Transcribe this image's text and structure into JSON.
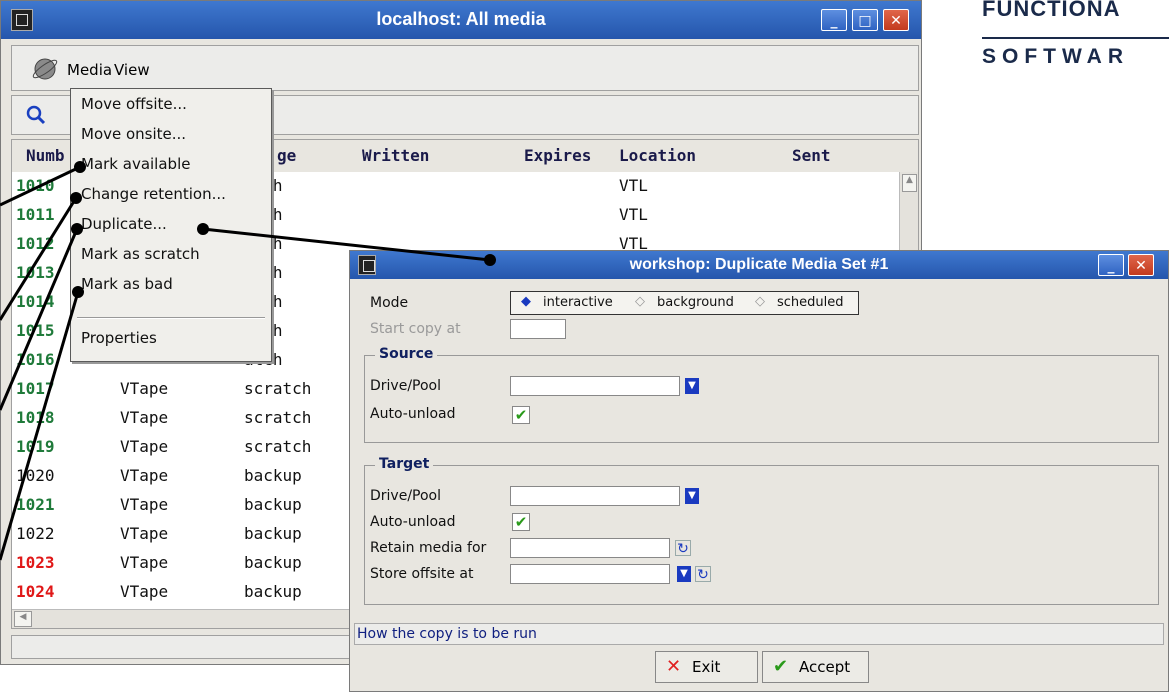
{
  "logo": {
    "line1": "FUNCTIONA",
    "line2": "SOFTWAR"
  },
  "main_window": {
    "title": "localhost: All media",
    "menus": [
      "Media",
      "View"
    ],
    "columns": [
      "Numb",
      "ge",
      "Written",
      "Expires",
      "Location",
      "Sent"
    ],
    "rows": [
      {
        "number": "1010",
        "type": "",
        "stage": "atch",
        "location": "VTL",
        "color": "#1f7a3a"
      },
      {
        "number": "1011",
        "type": "",
        "stage": "atch",
        "location": "VTL",
        "color": "#1f7a3a"
      },
      {
        "number": "1012",
        "type": "",
        "stage": "atch",
        "location": "VTL",
        "color": "#1f7a3a"
      },
      {
        "number": "1013",
        "type": "",
        "stage": "atch",
        "location": "",
        "color": "#1f7a3a"
      },
      {
        "number": "1014",
        "type": "",
        "stage": "atch",
        "location": "",
        "color": "#1f7a3a"
      },
      {
        "number": "1015",
        "type": "",
        "stage": "atch",
        "location": "",
        "color": "#1f7a3a"
      },
      {
        "number": "1016",
        "type": "",
        "stage": "atch",
        "location": "",
        "color": "#1f7a3a"
      },
      {
        "number": "1017",
        "type": "VTape",
        "stage": "scratch",
        "location": "",
        "color": "#1f7a3a"
      },
      {
        "number": "1018",
        "type": "VTape",
        "stage": "scratch",
        "location": "",
        "color": "#1f7a3a"
      },
      {
        "number": "1019",
        "type": "VTape",
        "stage": "scratch",
        "location": "",
        "color": "#1f7a3a"
      },
      {
        "number": "1020",
        "type": "VTape",
        "stage": "backup",
        "location": "",
        "color": "#111111"
      },
      {
        "number": "1021",
        "type": "VTape",
        "stage": "backup",
        "location": "",
        "color": "#1f7a3a"
      },
      {
        "number": "1022",
        "type": "VTape",
        "stage": "backup",
        "location": "",
        "color": "#111111"
      },
      {
        "number": "1023",
        "type": "VTape",
        "stage": "backup",
        "location": "",
        "color": "#e01818"
      },
      {
        "number": "1024",
        "type": "VTape",
        "stage": "backup",
        "location": "",
        "color": "#e01818"
      }
    ]
  },
  "dropdown": {
    "items": [
      "Move offsite...",
      "Move onsite...",
      "Mark available",
      "Change retention...",
      "Duplicate...",
      "Mark as scratch",
      "Mark as bad"
    ],
    "properties": "Properties"
  },
  "dialog": {
    "title": "workshop: Duplicate Media Set #1",
    "mode_label": "Mode",
    "mode_options": [
      "interactive",
      "background",
      "scheduled"
    ],
    "mode_selected": "interactive",
    "start_copy_label": "Start copy at",
    "source_title": "Source",
    "source_drive_label": "Drive/Pool",
    "source_autounload_label": "Auto-unload",
    "target_title": "Target",
    "target_drive_label": "Drive/Pool",
    "target_autounload_label": "Auto-unload",
    "retain_label": "Retain media for",
    "store_offsite_label": "Store offsite at",
    "status_text": "How the copy is to be run",
    "exit_label": "Exit",
    "accept_label": "Accept"
  },
  "colors": {
    "titlebar": "#2f63c2",
    "green_number": "#1f7a3a",
    "red_number": "#e01818"
  }
}
